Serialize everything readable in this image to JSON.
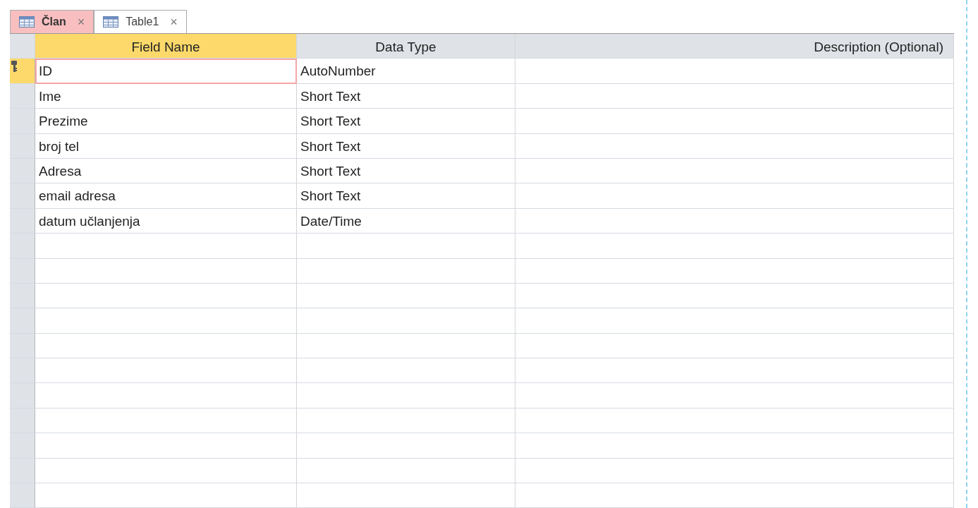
{
  "tabs": [
    {
      "label": "Član",
      "close": "×",
      "selected": true
    },
    {
      "label": "Table1",
      "close": "×",
      "selected": false
    }
  ],
  "table": {
    "columns": [
      "Field Name",
      "Data Type",
      "Description (Optional)"
    ],
    "rows": [
      {
        "field_name": "ID",
        "data_type": "AutoNumber",
        "primary_key": true,
        "selected": true
      },
      {
        "field_name": "Ime",
        "data_type": "Short Text",
        "primary_key": false,
        "selected": false
      },
      {
        "field_name": "Prezime",
        "data_type": "Short Text",
        "primary_key": false,
        "selected": false
      },
      {
        "field_name": "broj tel",
        "data_type": "Short Text",
        "primary_key": false,
        "selected": false
      },
      {
        "field_name": "Adresa",
        "data_type": "Short Text",
        "primary_key": false,
        "selected": false
      },
      {
        "field_name": "email adresa",
        "data_type": "Short Text",
        "primary_key": false,
        "selected": false
      },
      {
        "field_name": "datum učlanjenja",
        "data_type": "Date/Time",
        "primary_key": false,
        "selected": false
      }
    ]
  }
}
